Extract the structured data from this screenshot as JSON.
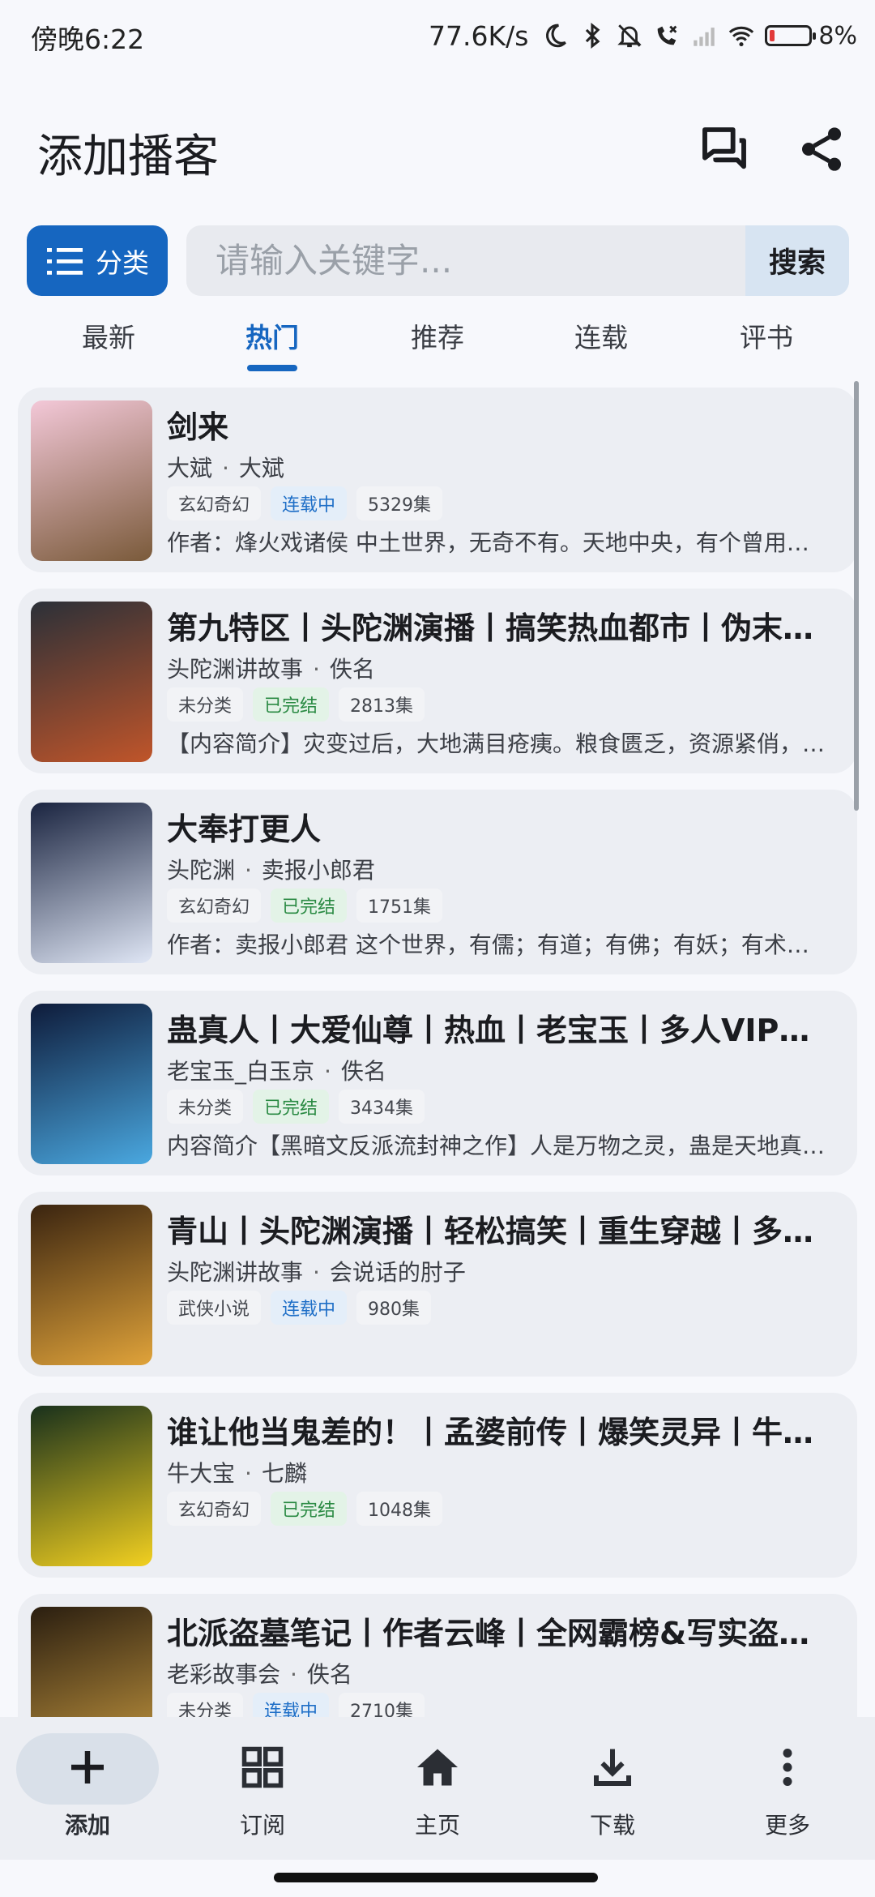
{
  "status_bar": {
    "time": "傍晚6:22",
    "net_speed": "77.6K/s",
    "battery_pct": "8%"
  },
  "header": {
    "title": "添加播客",
    "icons": [
      "chat-icon",
      "share-icon"
    ]
  },
  "search": {
    "category_label": "分类",
    "placeholder": "请输入关键字...",
    "value": "",
    "button": "搜索"
  },
  "tabs": [
    {
      "label": "最新"
    },
    {
      "label": "热门",
      "active": true
    },
    {
      "label": "推荐"
    },
    {
      "label": "连载"
    },
    {
      "label": "评书"
    }
  ],
  "podcasts": [
    {
      "title": "剑来",
      "author": "大斌",
      "narrator": "大斌",
      "category": "玄幻奇幻",
      "status": "连载中",
      "status_type": "ongoing",
      "episodes": "5329集",
      "desc": "作者：烽火戏诸侯 中土世界，无奇不有。天地中央，有个曾用名为骊珠的洞天福地",
      "cover_colors": [
        "#f3c8d8",
        "#7a5a3a"
      ]
    },
    {
      "title": "第九特区丨头陀渊演播丨搞笑热血都市丨伪末世丨多人有声剧",
      "author": "头陀渊讲故事",
      "narrator": "佚名",
      "category": "未分类",
      "status": "已完结",
      "status_type": "done",
      "episodes": "2813集",
      "desc": "【内容简介】灾变过后，大地满目疮痍。粮食匮乏，资源紧俏，人们在废墟中求生",
      "cover_colors": [
        "#2b3038",
        "#c0552a"
      ]
    },
    {
      "title": "大奉打更人",
      "author": "头陀渊",
      "narrator": "卖报小郎君",
      "category": "玄幻奇幻",
      "status": "已完结",
      "status_type": "done",
      "episodes": "1751集",
      "desc": "作者：卖报小郎君 这个世界，有儒；有道；有佛；有妖；有术士。警校毕业的许七安",
      "cover_colors": [
        "#1a2440",
        "#dfe6f5"
      ]
    },
    {
      "title": "蛊真人丨大爱仙尊丨热血丨老宝玉丨多人VIP有声剧",
      "author": "老宝玉_白玉京",
      "narrator": "佚名",
      "category": "未分类",
      "status": "已完结",
      "status_type": "done",
      "episodes": "3434集",
      "desc": "内容简介【黑暗文反派流封神之作】人是万物之灵，蛊是天地真精。三观不正魔头重生",
      "cover_colors": [
        "#0e1b3a",
        "#4aa8e0"
      ]
    },
    {
      "title": "青山丨头陀渊演播丨轻松搞笑丨重生穿越丨多人有声剧",
      "author": "头陀渊讲故事",
      "narrator": "会说话的肘子",
      "category": "武侠小说",
      "status": "连载中",
      "status_type": "ongoing",
      "episodes": "980集",
      "desc": "",
      "cover_colors": [
        "#3a2410",
        "#e0a33a"
      ]
    },
    {
      "title": "谁让他当鬼差的！丨孟婆前传丨爆笑灵异丨牛大宝",
      "author": "牛大宝",
      "narrator": "七麟",
      "category": "玄幻奇幻",
      "status": "已完结",
      "status_type": "done",
      "episodes": "1048集",
      "desc": "",
      "cover_colors": [
        "#18301c",
        "#f2d020"
      ]
    },
    {
      "title": "北派盗墓笔记丨作者云峰丨全网霸榜&写实盗墓丨多人有声剧",
      "author": "老彩故事会",
      "narrator": "佚名",
      "category": "未分类",
      "status": "连载中",
      "status_type": "ongoing",
      "episodes": "2710集",
      "desc": "",
      "cover_colors": [
        "#2a1e10",
        "#c89a40"
      ]
    }
  ],
  "bottom_nav": [
    {
      "label": "添加",
      "icon": "plus-icon",
      "active": true
    },
    {
      "label": "订阅",
      "icon": "grid-icon"
    },
    {
      "label": "主页",
      "icon": "home-icon"
    },
    {
      "label": "下载",
      "icon": "download-icon"
    },
    {
      "label": "更多",
      "icon": "more-vert-icon"
    }
  ]
}
